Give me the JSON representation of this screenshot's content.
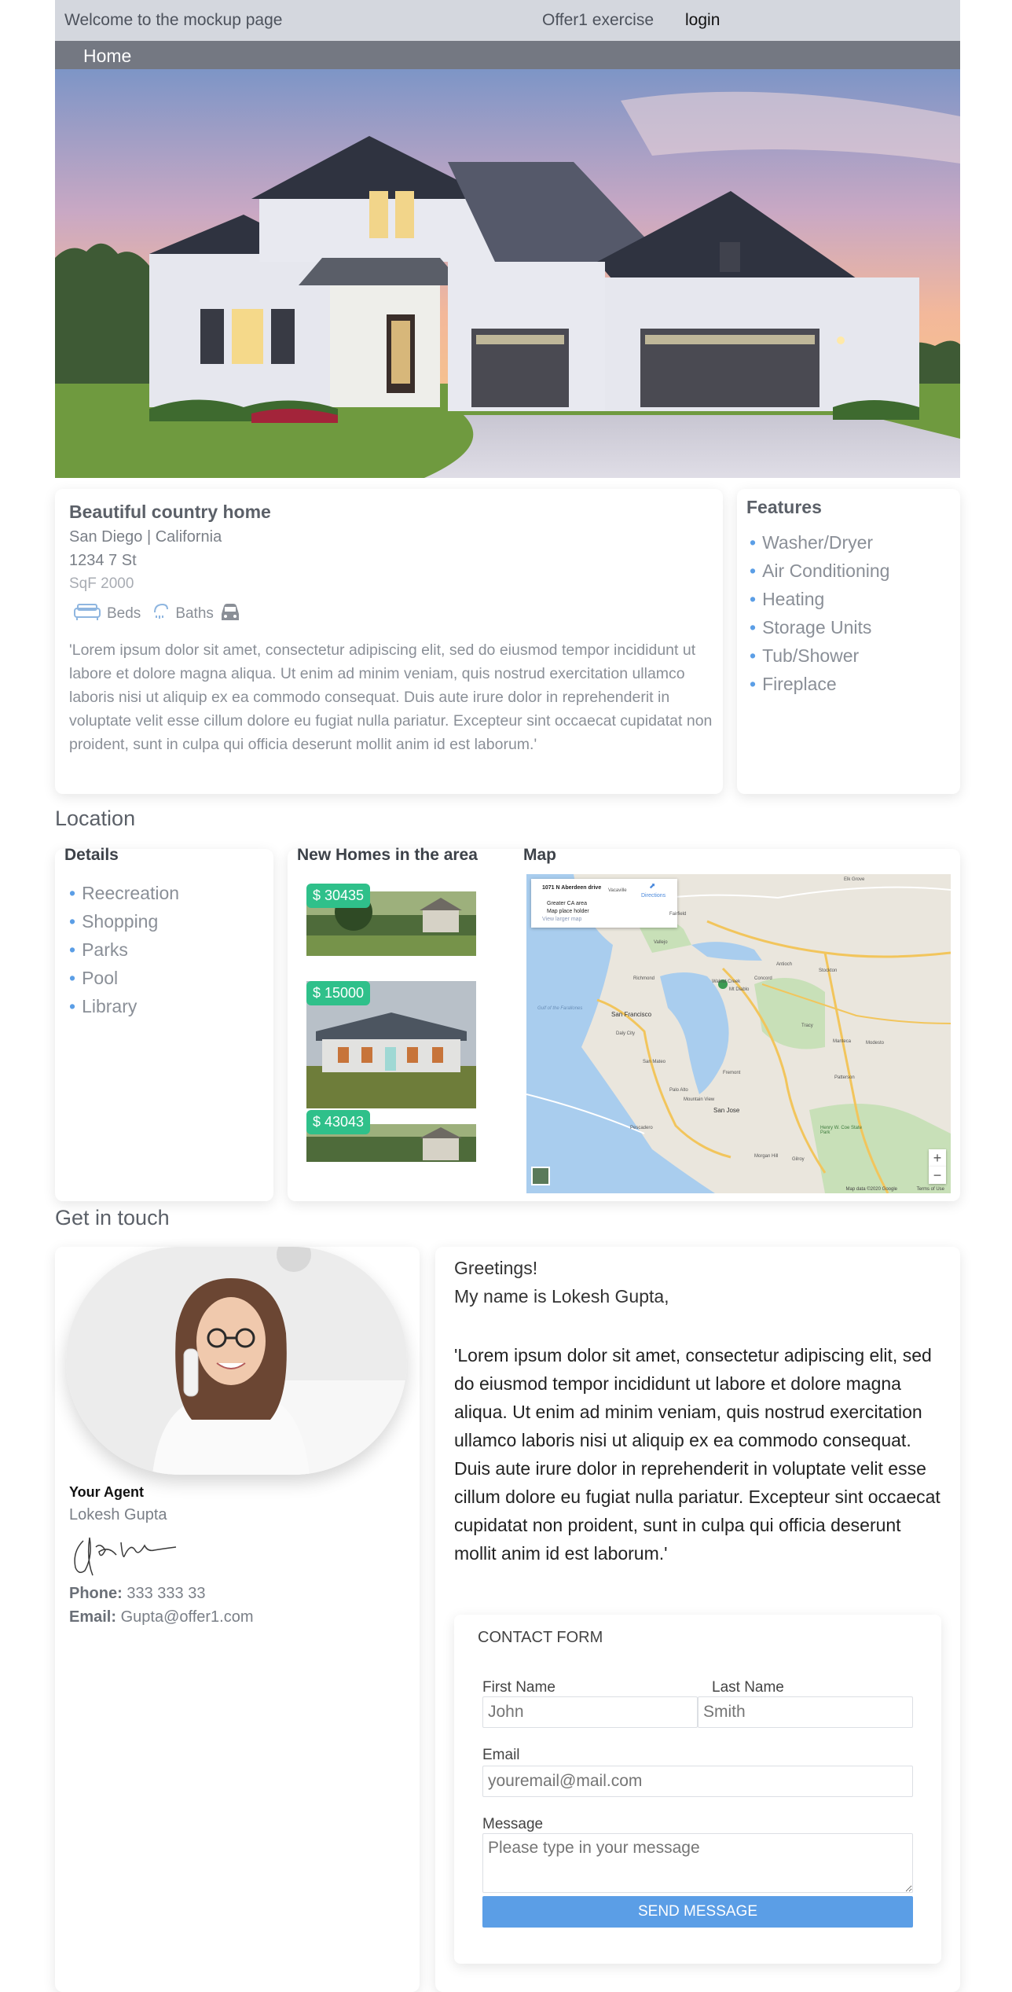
{
  "header": {
    "welcome": "Welcome to the mockup page",
    "offer_link": "Offer1 exercise",
    "login_link": "login",
    "nav_home": "Home"
  },
  "listing": {
    "title": "Beautiful country home",
    "city_state": "San Diego | California",
    "street": "1234 7 St",
    "sqf": "SqF 2000",
    "beds_label": "Beds",
    "baths_label": "Baths",
    "description": "'Lorem ipsum dolor sit amet, consectetur adipiscing elit, sed do eiusmod tempor incididunt ut labore et dolore magna aliqua. Ut enim ad minim veniam, quis nostrud exercitation ullamco laboris nisi ut aliquip ex ea commodo consequat. Duis aute irure dolor in reprehenderit in voluptate velit esse cillum dolore eu fugiat nulla pariatur. Excepteur sint occaecat cupidatat non proident, sunt in culpa qui officia deserunt mollit anim id est laborum.'"
  },
  "features": {
    "title": "Features",
    "items": [
      "Washer/Dryer",
      "Air Conditioning",
      "Heating",
      "Storage Units",
      "Tub/Shower",
      "Fireplace"
    ]
  },
  "location": {
    "section_title": "Location",
    "details_title": "Details",
    "details": [
      "Reecreation",
      "Shopping",
      "Parks",
      "Pool",
      "Library"
    ],
    "new_homes_title": "New Homes in the area",
    "new_homes": [
      {
        "price": "$ 30435"
      },
      {
        "price": "$ 15000"
      },
      {
        "price": "$ 43043"
      }
    ],
    "map_title": "Map",
    "map_info_line1": "1071 N Aberdeen drive",
    "map_info_line2": "Greater CA area",
    "map_info_line3": "Map place holder",
    "map_info_link": "View larger map",
    "map_directions": "Directions",
    "map_footer": "Map data ©2020 Google",
    "map_terms": "Terms of Use",
    "map_places": [
      "Vacaville",
      "Elk Grove",
      "Fairfield",
      "Vallejo",
      "Richmond",
      "Walnut Creek",
      "Mt Diablo",
      "Concord",
      "Stockton",
      "Antioch",
      "San Francisco",
      "Daly City",
      "San Mateo",
      "Fremont",
      "Palo Alto",
      "Mountain View",
      "San Jose",
      "Tracy",
      "Manteca",
      "Modesto",
      "Patterson",
      "Gilroy",
      "Morgan Hill",
      "Henry W. Coe State Park",
      "Pescadero",
      "Gulf of the Farallones"
    ]
  },
  "contact": {
    "section_title": "Get in touch",
    "agent_role": "Your Agent",
    "agent_name": "Lokesh Gupta",
    "phone_label": "Phone:",
    "phone": "333 333 33",
    "email_label": "Email:",
    "email": "Gupta@offer1.com",
    "greeting": "Greetings!",
    "intro": "My name is Lokesh Gupta,",
    "message": "'Lorem ipsum dolor sit amet, consectetur adipiscing elit, sed do eiusmod tempor incididunt ut labore et dolore magna aliqua. Ut enim ad minim veniam, quis nostrud exercitation ullamco laboris nisi ut aliquip ex ea commodo consequat. Duis aute irure dolor in reprehenderit in voluptate velit esse cillum dolore eu fugiat nulla pariatur. Excepteur sint occaecat cupidatat non proident, sunt in culpa qui officia deserunt mollit anim id est laborum.'"
  },
  "form": {
    "title": "CONTACT FORM",
    "first_name_label": "First Name",
    "first_name_placeholder": "John",
    "last_name_label": "Last Name",
    "last_name_placeholder": "Smith",
    "email_label": "Email",
    "email_placeholder": "youremail@mail.com",
    "message_label": "Message",
    "message_placeholder": "Please type in your message",
    "submit_label": "SEND MESSAGE"
  },
  "colors": {
    "topbar": "#d4d7de",
    "navbar": "#747882",
    "accent": "#5b9ee6",
    "price_badge": "#2fc08a"
  },
  "icons": [
    "sofa-icon",
    "shower-icon",
    "car-icon",
    "directions-icon",
    "map-pin-icon",
    "zoom-in-icon",
    "zoom-out-icon"
  ]
}
